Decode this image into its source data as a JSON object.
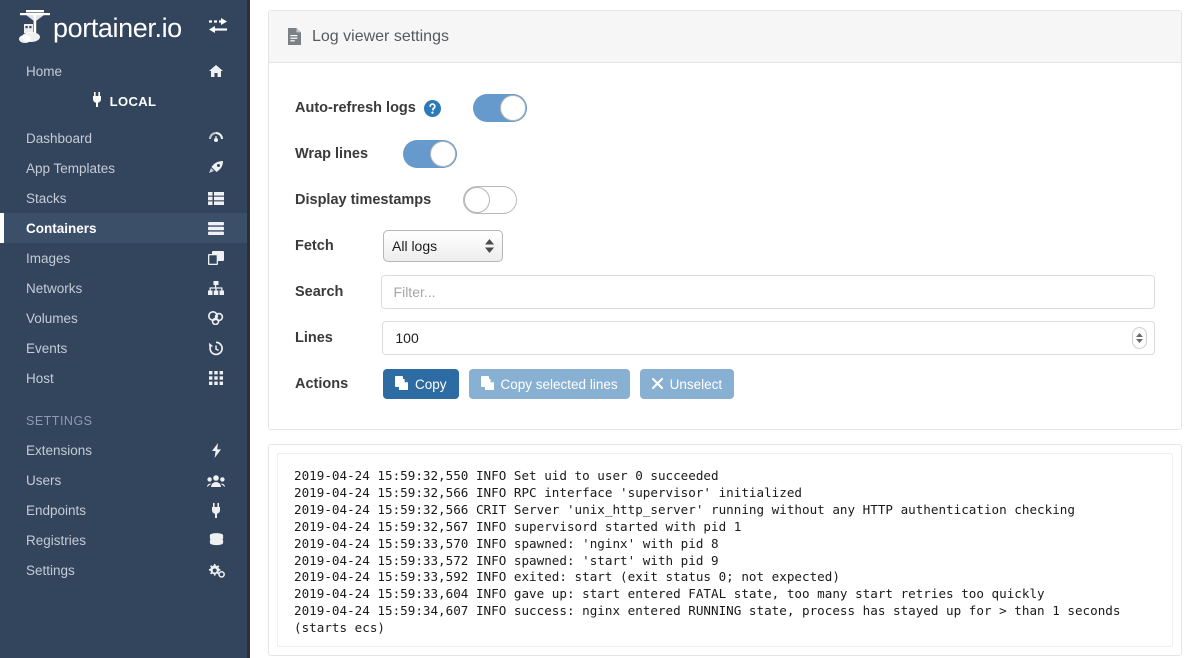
{
  "sidebar": {
    "brand": {
      "text": "portainer.io",
      "logo_icon": "crane-logo-icon",
      "toggle_icon": "collapse-arrows-icon"
    },
    "home": {
      "label": "Home",
      "icon": "home-icon"
    },
    "local_badge": {
      "label": "LOCAL",
      "icon": "plug-icon"
    },
    "items": [
      {
        "label": "Dashboard",
        "icon": "dashboard-icon",
        "active": false
      },
      {
        "label": "App Templates",
        "icon": "rocket-icon",
        "active": false
      },
      {
        "label": "Stacks",
        "icon": "stacks-icon",
        "active": false
      },
      {
        "label": "Containers",
        "icon": "containers-icon",
        "active": true
      },
      {
        "label": "Images",
        "icon": "images-icon",
        "active": false
      },
      {
        "label": "Networks",
        "icon": "networks-icon",
        "active": false
      },
      {
        "label": "Volumes",
        "icon": "volumes-icon",
        "active": false
      },
      {
        "label": "Events",
        "icon": "history-icon",
        "active": false
      },
      {
        "label": "Host",
        "icon": "grid-icon",
        "active": false
      }
    ],
    "settings_section": {
      "title": "SETTINGS",
      "items": [
        {
          "label": "Extensions",
          "icon": "bolt-icon"
        },
        {
          "label": "Users",
          "icon": "users-icon"
        },
        {
          "label": "Endpoints",
          "icon": "plug-icon"
        },
        {
          "label": "Registries",
          "icon": "database-icon"
        },
        {
          "label": "Settings",
          "icon": "gears-icon"
        }
      ]
    },
    "colors": {
      "background": "#33455c",
      "active_background": "#3b4f69",
      "text": "#c5cbd6"
    }
  },
  "panel": {
    "header": {
      "title": "Log viewer settings",
      "icon": "file-text-icon"
    },
    "auto_refresh": {
      "label": "Auto-refresh logs",
      "help_icon": "question-circle-icon",
      "state": "on"
    },
    "wrap_lines": {
      "label": "Wrap lines",
      "state": "on"
    },
    "display_timestamps": {
      "label": "Display timestamps",
      "state": "off"
    },
    "fetch": {
      "label": "Fetch",
      "value": "All logs"
    },
    "search": {
      "label": "Search",
      "value": "",
      "placeholder": "Filter..."
    },
    "lines": {
      "label": "Lines",
      "value": "100"
    },
    "actions": {
      "label": "Actions",
      "buttons": [
        {
          "label": "Copy",
          "icon": "copy-icon",
          "style": "primary"
        },
        {
          "label": "Copy selected lines",
          "icon": "copy-icon",
          "style": "light"
        },
        {
          "label": "Unselect",
          "icon": "times-icon",
          "style": "light"
        }
      ]
    },
    "colors": {
      "toggle_on": "#6699cc",
      "primary_button": "#2d6ca2",
      "light_button": "#88b0d3",
      "help_icon": "#2d7ab8"
    }
  },
  "log_output": {
    "lines": [
      "2019-04-24 15:59:32,550 INFO Set uid to user 0 succeeded",
      "2019-04-24 15:59:32,566 INFO RPC interface 'supervisor' initialized",
      "2019-04-24 15:59:32,566 CRIT Server 'unix_http_server' running without any HTTP authentication checking",
      "2019-04-24 15:59:32,567 INFO supervisord started with pid 1",
      "2019-04-24 15:59:33,570 INFO spawned: 'nginx' with pid 8",
      "2019-04-24 15:59:33,572 INFO spawned: 'start' with pid 9",
      "2019-04-24 15:59:33,592 INFO exited: start (exit status 0; not expected)",
      "2019-04-24 15:59:33,604 INFO gave up: start entered FATAL state, too many start retries too quickly",
      "2019-04-24 15:59:34,607 INFO success: nginx entered RUNNING state, process has stayed up for > than 1 seconds (starts ecs)"
    ]
  }
}
